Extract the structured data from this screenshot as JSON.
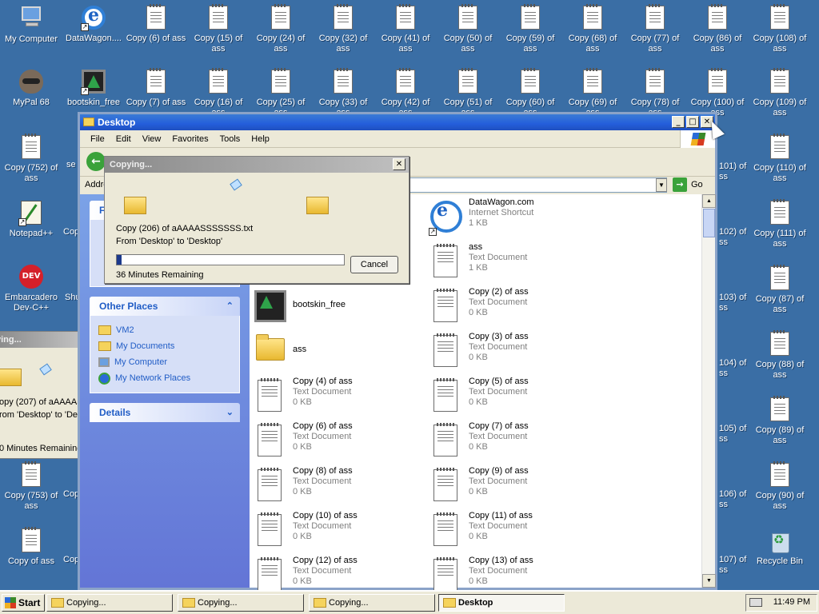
{
  "desktop_icons": [
    {
      "label": "My Computer",
      "icon": "computer-icon"
    },
    {
      "label": "DataWagon....",
      "icon": "internet-shortcut-icon"
    },
    {
      "label": "Copy (6) of ass",
      "icon": "text-document-icon"
    },
    {
      "label": "Copy (15) of ass",
      "icon": "text-document-icon"
    },
    {
      "label": "Copy (24) of ass",
      "icon": "text-document-icon"
    },
    {
      "label": "Copy (32) of ass",
      "icon": "text-document-icon"
    },
    {
      "label": "Copy (41) of ass",
      "icon": "text-document-icon"
    },
    {
      "label": "Copy (50) of ass",
      "icon": "text-document-icon"
    },
    {
      "label": "Copy (59) of ass",
      "icon": "text-document-icon"
    },
    {
      "label": "Copy (68) of ass",
      "icon": "text-document-icon"
    },
    {
      "label": "Copy (77) of ass",
      "icon": "text-document-icon"
    },
    {
      "label": "Copy (86) of ass",
      "icon": "text-document-icon"
    },
    {
      "label": "Copy (108) of ass",
      "icon": "text-document-icon"
    },
    {
      "label": "MyPal 68",
      "icon": "raccoon-icon"
    },
    {
      "label": "bootskin_free",
      "icon": "bootskin-icon"
    },
    {
      "label": "Copy (7) of ass",
      "icon": "text-document-icon"
    },
    {
      "label": "Copy (16) of ass",
      "icon": "text-document-icon"
    },
    {
      "label": "Copy (25) of ass",
      "icon": "text-document-icon"
    },
    {
      "label": "Copy (33) of ass",
      "icon": "text-document-icon"
    },
    {
      "label": "Copy (42) of ass",
      "icon": "text-document-icon"
    },
    {
      "label": "Copy (51) of ass",
      "icon": "text-document-icon"
    },
    {
      "label": "Copy (60) of ass",
      "icon": "text-document-icon"
    },
    {
      "label": "Copy (69) of ass",
      "icon": "text-document-icon"
    },
    {
      "label": "Copy (78) of ass",
      "icon": "text-document-icon"
    },
    {
      "label": "Copy (100) of ass",
      "icon": "text-document-icon"
    },
    {
      "label": "Copy (109) of ass",
      "icon": "text-document-icon"
    },
    {
      "label": "Copy (752) of ass",
      "icon": "text-document-icon"
    },
    {
      "label": "Copy (110) of ass",
      "icon": "text-document-icon"
    },
    {
      "label": "Notepad++",
      "icon": "notepad-plus-plus-icon"
    },
    {
      "label": "Copy (111) of ass",
      "icon": "text-document-icon"
    },
    {
      "label": "Embarcadero Dev-C++",
      "icon": "dev-cpp-icon"
    },
    {
      "label": "Copy (87) of ass",
      "icon": "text-document-icon"
    },
    {
      "label": "Copy (88) of ass",
      "icon": "text-document-icon"
    },
    {
      "label": "Copy (89) of ass",
      "icon": "text-document-icon"
    },
    {
      "label": "Copy (753) of ass",
      "icon": "text-document-icon"
    },
    {
      "label": "Copy (90) of ass",
      "icon": "text-document-icon"
    },
    {
      "label": "Copy of ass",
      "icon": "text-document-icon"
    },
    {
      "label": "Recycle Bin",
      "icon": "recycle-bin-icon"
    }
  ],
  "partial_labels": {
    "p1": "se",
    "p2": "Cop",
    "p3": "Shu",
    "p4": "Cop",
    "p5": "Cop",
    "r1": "101) of ss",
    "r2": "102) of ss",
    "r3": "103) of ss",
    "r4": "104) of ss",
    "r5": "105) of ss",
    "r6": "106) of ss",
    "r7": "107) of ss"
  },
  "window": {
    "title": "Desktop",
    "menu": [
      "File",
      "Edit",
      "View",
      "Favorites",
      "Tools",
      "Help"
    ],
    "address_label": "Addre",
    "go_label": "Go",
    "taskpane": {
      "partial_header": "F",
      "other_places": {
        "header": "Other Places",
        "links": [
          "VM2",
          "My Documents",
          "My Computer",
          "My Network Places"
        ]
      },
      "details": {
        "header": "Details"
      }
    },
    "files": [
      {
        "name": "DataWagon.com",
        "type": "Internet Shortcut",
        "size": "1 KB",
        "icon": "internet-shortcut-icon"
      },
      {
        "name": "ass",
        "type": "Text Document",
        "size": "1 KB",
        "icon": "text-document-icon"
      },
      {
        "name": "bootskin_free",
        "type": "",
        "size": "",
        "icon": "bootskin-icon"
      },
      {
        "name": "Copy (2) of ass",
        "type": "Text Document",
        "size": "0 KB",
        "icon": "text-document-icon"
      },
      {
        "name": "ass",
        "type": "",
        "size": "",
        "icon": "folder-icon"
      },
      {
        "name": "Copy (3) of ass",
        "type": "Text Document",
        "size": "0 KB",
        "icon": "text-document-icon"
      },
      {
        "name": "Copy (4) of ass",
        "type": "Text Document",
        "size": "0 KB",
        "icon": "text-document-icon"
      },
      {
        "name": "Copy (5) of ass",
        "type": "Text Document",
        "size": "0 KB",
        "icon": "text-document-icon"
      },
      {
        "name": "Copy (6) of ass",
        "type": "Text Document",
        "size": "0 KB",
        "icon": "text-document-icon"
      },
      {
        "name": "Copy (7) of ass",
        "type": "Text Document",
        "size": "0 KB",
        "icon": "text-document-icon"
      },
      {
        "name": "Copy (8) of ass",
        "type": "Text Document",
        "size": "0 KB",
        "icon": "text-document-icon"
      },
      {
        "name": "Copy (9) of ass",
        "type": "Text Document",
        "size": "0 KB",
        "icon": "text-document-icon"
      },
      {
        "name": "Copy (10) of ass",
        "type": "Text Document",
        "size": "0 KB",
        "icon": "text-document-icon"
      },
      {
        "name": "Copy (11) of ass",
        "type": "Text Document",
        "size": "0 KB",
        "icon": "text-document-icon"
      },
      {
        "name": "Copy (12) of ass",
        "type": "Text Document",
        "size": "0 KB",
        "icon": "text-document-icon"
      },
      {
        "name": "Copy (13) of ass",
        "type": "Text Document",
        "size": "0 KB",
        "icon": "text-document-icon"
      }
    ]
  },
  "copy_dialog": {
    "title": "Copying...",
    "filename": "Copy (206) of aAAAASSSSSSS.txt",
    "from_to": "From 'Desktop' to 'Desktop'",
    "remaining": "36 Minutes Remaining",
    "progress": 0.02,
    "cancel_label": "Cancel"
  },
  "copy_dialog_2": {
    "title": "ying...",
    "filename": "opy (207) of aAAAAS",
    "from_to": "rom 'Desktop' to 'Des",
    "remaining": "0 Minutes Remaining"
  },
  "taskbar": {
    "start_label": "Start",
    "buttons": [
      {
        "label": "Copying...",
        "active": false
      },
      {
        "label": "Copying...",
        "active": false
      },
      {
        "label": "Copying...",
        "active": false
      },
      {
        "label": "Desktop",
        "active": true
      }
    ],
    "clock": "11:49 PM"
  }
}
